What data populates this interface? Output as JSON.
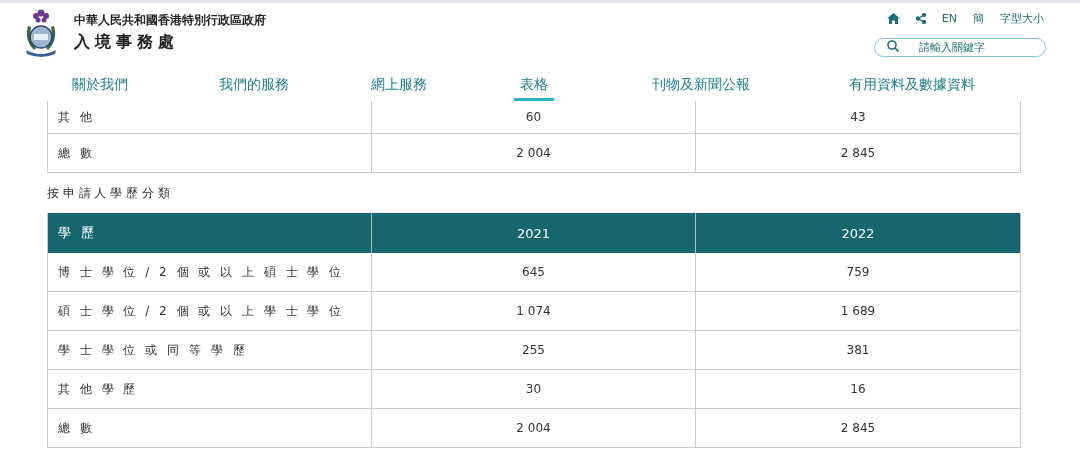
{
  "header": {
    "government": "中華人民共和國香港特別行政區政府",
    "department": "入境事務處"
  },
  "utility_links": [
    "EN",
    "簡",
    "字型大小"
  ],
  "search": {
    "placeholder": "請輸入關鍵字"
  },
  "nav": [
    {
      "label": "關於我們",
      "selected": false
    },
    {
      "label": "我們的服務",
      "selected": false
    },
    {
      "label": "網上服務",
      "selected": false
    },
    {
      "label": "表格",
      "selected": true
    },
    {
      "label": "刊物及新聞公報",
      "selected": false
    },
    {
      "label": "有用資料及數據資料",
      "selected": false
    }
  ],
  "table_top": {
    "rows": [
      [
        "其 他",
        "60",
        "43"
      ],
      [
        "總 數",
        "2 004",
        "2 845"
      ]
    ]
  },
  "section_title": "按 申 請 人 學 歷 分 類",
  "table": {
    "columns": [
      "學 歷",
      "2021",
      "2022"
    ],
    "rows": [
      [
        "博 士 學 位 / 2 個 或 以 上 碩 士 學 位",
        "645",
        "759"
      ],
      [
        "碩 士 學 位 / 2 個 或 以 上 學 士 學 位",
        "1 074",
        "1 689"
      ],
      [
        "學 士 學 位 或 同 等 學 歷",
        "255",
        "381"
      ],
      [
        "其 他 學 歷",
        "30",
        "16"
      ],
      [
        "總 數",
        "2 004",
        "2 845"
      ]
    ]
  }
}
